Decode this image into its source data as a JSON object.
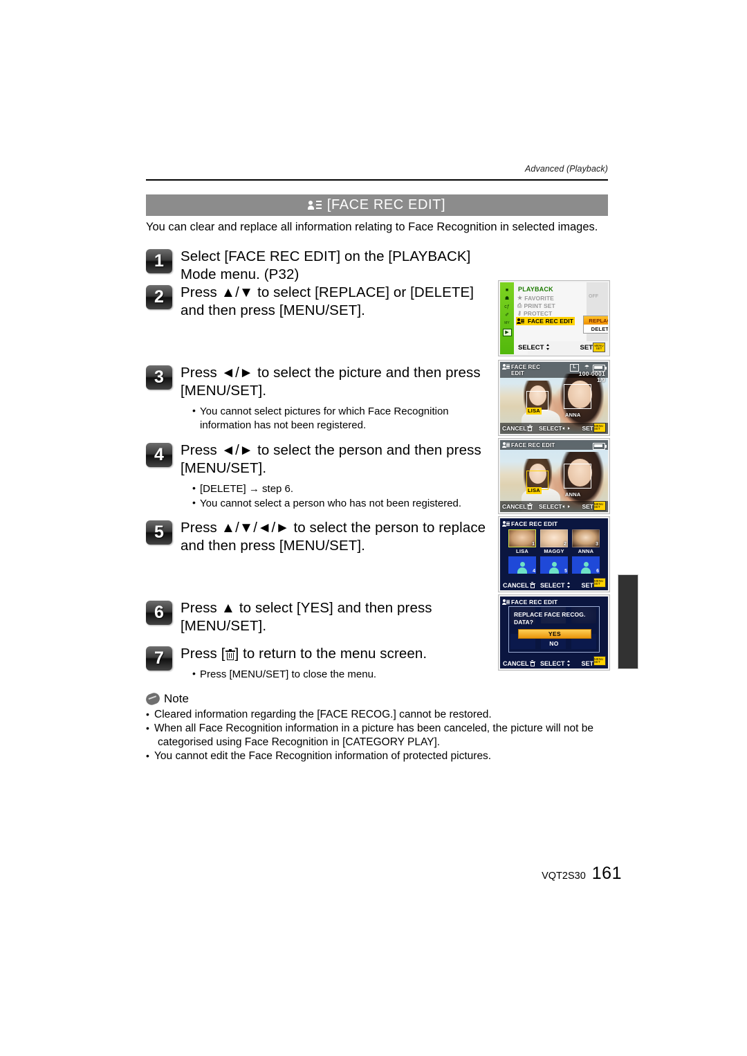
{
  "header": {
    "running_head": "Advanced (Playback)"
  },
  "title_bar": {
    "icon": "face-rec-icon",
    "text": "[FACE REC EDIT]"
  },
  "intro": "You can clear and replace all information relating to Face Recognition in selected images.",
  "steps": [
    {
      "num": "1",
      "text": "Select [FACE REC EDIT] on the [PLAYBACK] Mode menu. (P32)",
      "bullets": []
    },
    {
      "num": "2",
      "text": "Press ▲/▼ to select [REPLACE] or [DELETE] and then press [MENU/SET].",
      "bullets": []
    },
    {
      "num": "3",
      "text": "Press ◄/► to select the picture and then press [MENU/SET].",
      "bullets": [
        "You cannot select pictures for which Face Recognition information has not been registered."
      ]
    },
    {
      "num": "4",
      "text": "Press ◄/► to select the person and then press [MENU/SET].",
      "bullets": [
        "[DELETE] → step 6.",
        "You cannot select a person who has not been registered."
      ]
    },
    {
      "num": "5",
      "text": "Press ▲/▼/◄/► to select the person to replace and then press [MENU/SET].",
      "bullets": []
    },
    {
      "num": "6",
      "text": "Press ▲ to select [YES] and then press [MENU/SET].",
      "bullets": []
    },
    {
      "num": "7",
      "text_before": "Press [",
      "text_after": "] to return to the menu screen.",
      "icon": "trash-icon",
      "bullets": [
        "Press [MENU/SET] to close the menu."
      ]
    }
  ],
  "note": {
    "label": "Note",
    "items": [
      "Cleared information regarding the [FACE RECOG.] cannot be restored.",
      "When all Face Recognition information in a picture has been canceled, the picture will not be",
      "categorised using Face Recognition in [CATEGORY PLAY].",
      "You cannot edit the Face Recognition information of protected pictures."
    ]
  },
  "footer": {
    "code": "VQT2S30",
    "page": "161"
  },
  "screens": {
    "playback_menu": {
      "title": "PLAYBACK",
      "rows": [
        {
          "icon": "★",
          "label": "FAVORITE"
        },
        {
          "icon": "⎙",
          "label": "PRINT SET"
        },
        {
          "icon": "⚷",
          "label": "PROTECT"
        },
        {
          "icon": "face-rec-icon",
          "label": "FACE REC EDIT"
        }
      ],
      "favorite_value": "OFF",
      "dropdown": [
        "REPLACE",
        "DELETE"
      ],
      "select_label": "SELECT",
      "set_label": "SET",
      "menu_button": "MENU SET",
      "rail_icons": [
        "■",
        "☗",
        "cƒ",
        "✐",
        "MY",
        "▶"
      ]
    },
    "picture_select": {
      "title_line1": "FACE REC",
      "title_line2": "EDIT",
      "size_badge": "L",
      "file_no": "100-0001",
      "frame_no": "1/9",
      "name_left": "LISA",
      "name_right": "ANNA",
      "cancel_label": "CANCEL",
      "select_label": "SELECT",
      "set_label": "SET",
      "menu_button": "MENU SET"
    },
    "person_select": {
      "title": "FACE REC EDIT",
      "name_left": "LISA",
      "name_right": "ANNA",
      "cancel_label": "CANCEL",
      "select_label": "SELECT",
      "set_label": "SET",
      "menu_button": "MENU SET"
    },
    "person_grid": {
      "title": "FACE REC EDIT",
      "people": [
        {
          "num": "1",
          "name": "LISA",
          "registered": true
        },
        {
          "num": "2",
          "name": "MAGGY",
          "registered": true
        },
        {
          "num": "3",
          "name": "ANNA",
          "registered": true
        },
        {
          "num": "4",
          "name": "",
          "registered": false
        },
        {
          "num": "5",
          "name": "",
          "registered": false
        },
        {
          "num": "6",
          "name": "",
          "registered": false
        }
      ],
      "cancel_label": "CANCEL",
      "select_label": "SELECT",
      "set_label": "SET",
      "menu_button": "MENU SET"
    },
    "confirm": {
      "title": "FACE REC EDIT",
      "message": "REPLACE FACE RECOG. DATA?",
      "yes_label": "YES",
      "no_label": "NO",
      "cancel_label": "CANCEL",
      "select_label": "SELECT",
      "set_label": "SET",
      "menu_button": "MENU SET"
    }
  },
  "colors": {
    "title_bar_bg": "#8c8c8c",
    "menu_rail_green": "#52b80c",
    "highlight_yellow": "#ffd200",
    "lcd_blue": "#0b1640"
  }
}
